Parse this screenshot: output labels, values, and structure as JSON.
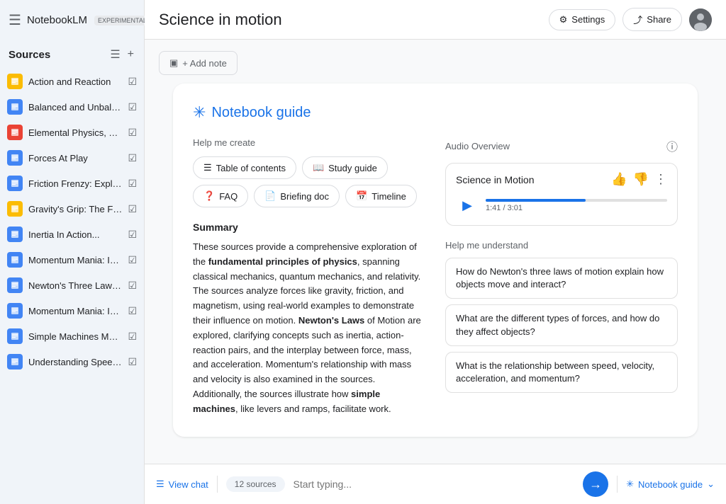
{
  "app": {
    "name": "NotebookLM",
    "badge": "EXPERIMENTAL"
  },
  "header": {
    "title": "Science in motion",
    "settings_label": "Settings",
    "share_label": "Share"
  },
  "sidebar": {
    "title": "Sources",
    "sources": [
      {
        "id": 1,
        "name": "Action and Reaction",
        "icon_type": "yellow",
        "checked": true
      },
      {
        "id": 2,
        "name": "Balanced and Unbalanc...",
        "icon_type": "blue",
        "checked": true
      },
      {
        "id": 3,
        "name": "Elemental Physics, Third...",
        "icon_type": "red",
        "checked": true
      },
      {
        "id": 4,
        "name": "Forces At Play",
        "icon_type": "blue",
        "checked": true
      },
      {
        "id": 5,
        "name": "Friction Frenzy: Explorin...",
        "icon_type": "blue",
        "checked": true
      },
      {
        "id": 6,
        "name": "Gravity's Grip: The Force...",
        "icon_type": "yellow",
        "checked": true
      },
      {
        "id": 7,
        "name": "Inertia In Action...",
        "icon_type": "blue",
        "checked": true
      },
      {
        "id": 8,
        "name": "Momentum Mania: Inves...",
        "icon_type": "blue",
        "checked": true
      },
      {
        "id": 9,
        "name": "Newton's Three Laws...",
        "icon_type": "blue",
        "checked": true
      },
      {
        "id": 10,
        "name": "Momentum Mania: Inves...",
        "icon_type": "blue",
        "checked": true
      },
      {
        "id": 11,
        "name": "Simple Machines Make...",
        "icon_type": "blue",
        "checked": true
      },
      {
        "id": 12,
        "name": "Understanding Speed, Ve...",
        "icon_type": "blue",
        "checked": true
      }
    ]
  },
  "studio": {
    "add_note_label": "+ Add note",
    "notebook_guide": {
      "title": "Notebook guide",
      "help_create_label": "Help me create",
      "buttons": [
        {
          "id": "toc",
          "label": "Table of contents"
        },
        {
          "id": "study",
          "label": "Study guide"
        },
        {
          "id": "faq",
          "label": "FAQ"
        },
        {
          "id": "brief",
          "label": "Briefing doc"
        },
        {
          "id": "timeline",
          "label": "Timeline"
        }
      ],
      "audio_overview": {
        "label": "Audio Overview",
        "title": "Science in Motion",
        "time_current": "1:41",
        "time_total": "3:01",
        "progress_percent": 55
      },
      "summary": {
        "title": "Summary",
        "text_parts": [
          "These sources provide a comprehensive exploration of the ",
          "fundamental principles of physics",
          ", spanning classical mechanics, quantum mechanics, and relativity. The sources analyze forces like gravity, friction, and magnetism, using real-world examples to demonstrate their influence on motion. ",
          "Newton's Laws",
          " of Motion are explored, clarifying concepts such as inertia, action-reaction pairs, and the interplay between force, mass, and acceleration. Momentum's relationship with mass and velocity is also examined in the sources. Additionally, the sources illustrate how ",
          "simple machines",
          ", like levers and ramps, facilitate work."
        ]
      },
      "help_understand": {
        "label": "Help me understand",
        "questions": [
          "How do Newton's three laws of motion explain how objects move and interact?",
          "What are the different types of forces, and how do they affect objects?",
          "What is the relationship between speed, velocity, acceleration, and momentum?"
        ]
      }
    }
  },
  "bottom_bar": {
    "view_chat_label": "View chat",
    "sources_badge": "12 sources",
    "input_placeholder": "Start typing...",
    "notebook_guide_label": "Notebook guide"
  }
}
